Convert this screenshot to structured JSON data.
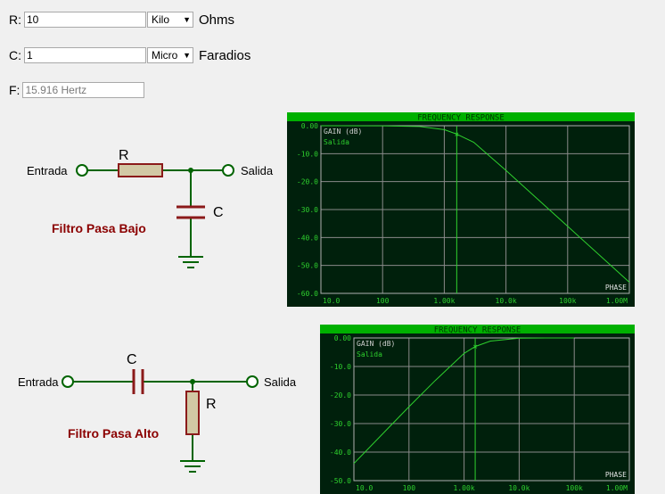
{
  "form": {
    "r_label": "R:",
    "r_value": "10",
    "r_unit": "Kilo",
    "r_suffix": "Ohms",
    "c_label": "C:",
    "c_value": "1",
    "c_unit": "Micro",
    "c_suffix": "Faradios",
    "f_label": "F:",
    "f_placeholder": "15.916 Hertz"
  },
  "lowpass": {
    "input_label": "Entrada",
    "output_label": "Salida",
    "r_label": "R",
    "c_label": "C",
    "title": "Filtro Pasa Bajo"
  },
  "highpass": {
    "input_label": "Entrada",
    "output_label": "Salida",
    "r_label": "R",
    "c_label": "C",
    "title": "Filtro Pasa Alto"
  },
  "colors": {
    "circuit_wire": "#006400",
    "resistor_fill": "#d2c9a5",
    "resistor_stroke": "#8b1a1a",
    "title_red": "#8b0000",
    "plot_bg": "#00200c",
    "plot_header": "#00b000",
    "plot_line": "#2ed12e"
  },
  "chart_data": [
    {
      "type": "line",
      "title": "FREQUENCY RESPONSE",
      "ylabel": "GAIN (dB)",
      "xlabel": "",
      "x_scale": "log",
      "x_ticks": [
        "10.0",
        "100",
        "1.00k",
        "10.0k",
        "100k",
        "1.00M"
      ],
      "y_ticks": [
        "0.00",
        "-10.0",
        "-20.0",
        "-30.0",
        "-40.0",
        "-50.0",
        "-60.0"
      ],
      "ylim": [
        -60,
        0
      ],
      "xlim": [
        10,
        1000000
      ],
      "grid": true,
      "series": [
        {
          "name": "Salida",
          "x": [
            10,
            100,
            400,
            1000,
            1591.6,
            3000,
            10000,
            100000,
            1000000
          ],
          "y": [
            0,
            -0.02,
            -0.3,
            -1.4,
            -3.0,
            -5.9,
            -16.0,
            -36.0,
            -56.0
          ]
        }
      ],
      "marker": {
        "x": 1591.6,
        "y": -3.0
      },
      "corner_label": "PHASE"
    },
    {
      "type": "line",
      "title": "FREQUENCY RESPONSE",
      "ylabel": "GAIN (dB)",
      "xlabel": "",
      "x_scale": "log",
      "x_ticks": [
        "10.0",
        "100",
        "1.00k",
        "10.0k",
        "100k",
        "1.00M"
      ],
      "y_ticks": [
        "0.00",
        "-10.0",
        "-20.0",
        "-30.0",
        "-40.0",
        "-50.0"
      ],
      "ylim": [
        -50,
        0
      ],
      "xlim": [
        10,
        1000000
      ],
      "grid": true,
      "series": [
        {
          "name": "Salida",
          "x": [
            10,
            30,
            100,
            300,
            1000,
            1591.6,
            3000,
            10000,
            30000,
            100000
          ],
          "y": [
            -44.0,
            -34.5,
            -24.1,
            -14.9,
            -5.4,
            -3.0,
            -1.1,
            -0.1,
            -0.01,
            0
          ]
        }
      ],
      "marker": {
        "x": 1591.6,
        "y": -3.0
      },
      "corner_label": "PHASE"
    }
  ]
}
